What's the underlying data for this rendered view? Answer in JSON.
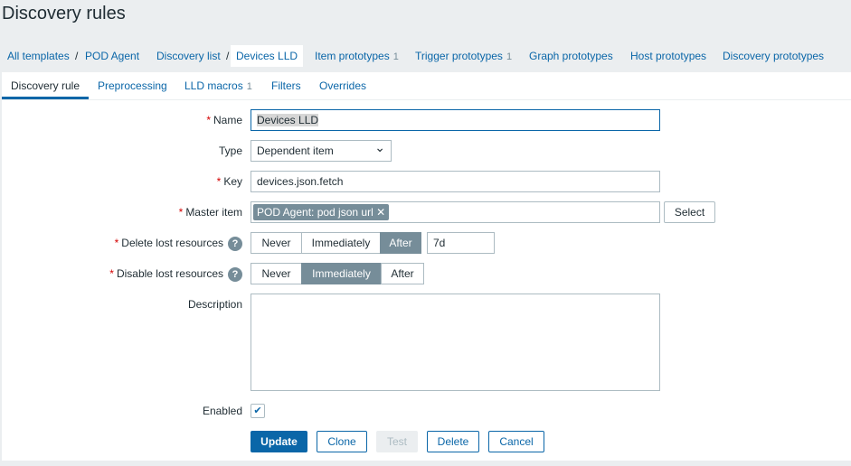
{
  "page_title": "Discovery rules",
  "breadcrumbs": [
    {
      "label": "All templates"
    },
    {
      "label": "POD Agent"
    },
    {
      "label": "Discovery list"
    },
    {
      "label": "Devices LLD"
    },
    {
      "label": "Item prototypes",
      "count": "1"
    },
    {
      "label": "Trigger prototypes",
      "count": "1"
    },
    {
      "label": "Graph prototypes"
    },
    {
      "label": "Host prototypes"
    },
    {
      "label": "Discovery prototypes"
    }
  ],
  "separator": "/",
  "tabs": [
    {
      "label": "Discovery rule"
    },
    {
      "label": "Preprocessing"
    },
    {
      "label": "LLD macros",
      "count": "1"
    },
    {
      "label": "Filters"
    },
    {
      "label": "Overrides"
    }
  ],
  "form": {
    "required_mark": "*",
    "help_glyph": "?",
    "name": {
      "label": "Name",
      "value": "Devices LLD"
    },
    "type": {
      "label": "Type",
      "value": "Dependent item",
      "arrow": "⌄"
    },
    "key": {
      "label": "Key",
      "value": "devices.json.fetch"
    },
    "master_item": {
      "label": "Master item",
      "tag": "POD Agent: pod json url",
      "remove": "✕",
      "select_label": "Select"
    },
    "delete_lost": {
      "label": "Delete lost resources",
      "options": [
        "Never",
        "Immediately",
        "After"
      ],
      "selected": "After",
      "value": "7d"
    },
    "disable_lost": {
      "label": "Disable lost resources",
      "options": [
        "Never",
        "Immediately",
        "After"
      ],
      "selected": "Immediately"
    },
    "description": {
      "label": "Description",
      "value": ""
    },
    "enabled": {
      "label": "Enabled",
      "checked": true,
      "check": "✔"
    }
  },
  "buttons": {
    "update": "Update",
    "clone": "Clone",
    "test": "Test",
    "delete": "Delete",
    "cancel": "Cancel"
  }
}
